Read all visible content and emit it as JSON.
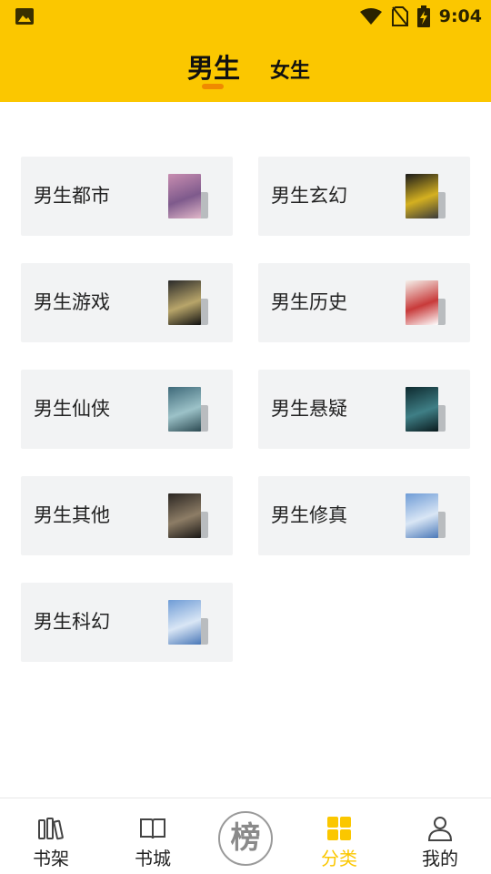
{
  "status_bar": {
    "time": "9:04",
    "icons": [
      "image-icon",
      "wifi-icon",
      "no-sim-icon",
      "battery-charging-icon"
    ]
  },
  "tabs": {
    "male": "男生",
    "female": "女生"
  },
  "categories": [
    {
      "label": "男生都市",
      "cover_colors": [
        "#c88db0",
        "#7e5a8c",
        "#e0b6c8"
      ]
    },
    {
      "label": "男生玄幻",
      "cover_colors": [
        "#1a1a1a",
        "#d4b020",
        "#3a3a3a"
      ]
    },
    {
      "label": "男生游戏",
      "cover_colors": [
        "#2a2a2a",
        "#b8a56a",
        "#111111"
      ]
    },
    {
      "label": "男生历史",
      "cover_colors": [
        "#f5f0ea",
        "#c83a3a",
        "#ffffff"
      ]
    },
    {
      "label": "男生仙侠",
      "cover_colors": [
        "#3f6a7a",
        "#9cc2c8",
        "#2c4a52"
      ]
    },
    {
      "label": "男生悬疑",
      "cover_colors": [
        "#0e2a2f",
        "#3f7f86",
        "#0a1a1d"
      ]
    },
    {
      "label": "男生其他",
      "cover_colors": [
        "#2b2622",
        "#8d7d66",
        "#1a1715"
      ]
    },
    {
      "label": "男生修真",
      "cover_colors": [
        "#6f9cd6",
        "#d9e6f5",
        "#4a78b8"
      ]
    },
    {
      "label": "男生科幻",
      "cover_colors": [
        "#6f9cd6",
        "#d9e6f5",
        "#4a78b8"
      ]
    }
  ],
  "bottom_nav": {
    "bookshelf": "书架",
    "bookstore": "书城",
    "rank": "榜",
    "category": "分类",
    "mine": "我的"
  },
  "colors": {
    "accent": "#FBC700",
    "indicator": "#F08A00",
    "card_bg": "#F2F3F4"
  }
}
